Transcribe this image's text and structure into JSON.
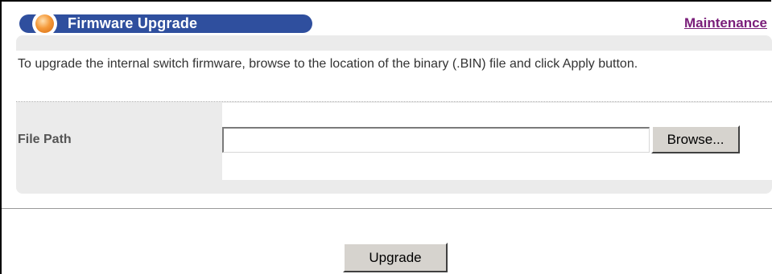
{
  "header": {
    "title": "Firmware Upgrade",
    "maintenance_link": "Maintenance"
  },
  "description": "To upgrade the internal switch firmware, browse to the location of the binary (.BIN) file and click Apply button.",
  "form": {
    "file_path_label": "File Path",
    "file_path_value": "",
    "browse_label": "Browse..."
  },
  "actions": {
    "upgrade_label": "Upgrade"
  },
  "colors": {
    "title_bar": "#2f4f9e",
    "title_dot": "#f59a3a",
    "link": "#7a1e7a",
    "panel": "#ebebeb",
    "button_face": "#d6d3ce"
  },
  "icons": {
    "title_bullet": "orange-ball-icon"
  }
}
